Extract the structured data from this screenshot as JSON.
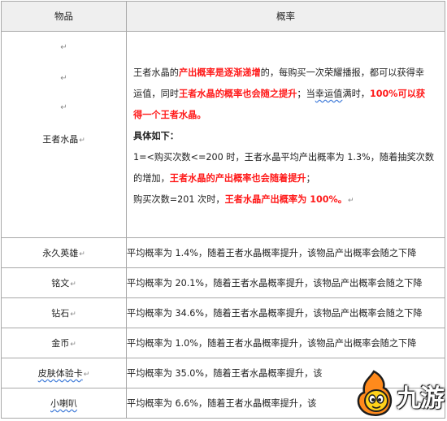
{
  "header": {
    "col1": "物品",
    "col2": "概率"
  },
  "para_mark": "↵",
  "crystal": {
    "name": "王者水晶",
    "line1_a": "王者水晶的",
    "line1_b": "产出概率是逐渐递增",
    "line1_c": "的，每购买一次荣耀播报，都可以获得幸",
    "line2_a": "运值，同时",
    "line2_b": "王者水晶的概率也会随之提升",
    "line2_c": "；当",
    "line2_d": "幸运值",
    "line2_e": "满时，",
    "line2_f": "100%可以获",
    "line3": "得一个王者水晶。",
    "detail_title": "具体如下：",
    "rule1": "1=<购买次数<=200 时，王者水晶平均产出概率为 1.3%，随着抽奖次数",
    "rule2_a": "的增加，",
    "rule2_b": "王者水晶的产出概率也会随着提升",
    "rule2_c": "；",
    "rule3_a": "购买次数=201 次时，",
    "rule3_b": "王者水晶产出概率为 100%。"
  },
  "rows": [
    {
      "item": "永久英雄",
      "prob": "平均概率为 1.4%，随着王者水晶概率提升，该物品产出概率会随之下降"
    },
    {
      "item": "铭文",
      "prob": "平均概率为 20.1%，随着王者水晶概率提升，该物品产出概率会随之下降"
    },
    {
      "item": "钻石",
      "prob": "平均概率为 34.6%，随着王者水晶概率提升，该物品产出概率会随之下降"
    },
    {
      "item": "金币",
      "prob": "平均概率为 1.0%，随着王者水晶概率提升，该物品产出概率会随之下降"
    },
    {
      "item": "皮肤体验卡",
      "prob": "平均概率为 35.0%，随着王者水晶概率提升，该"
    },
    {
      "item": "小喇叭",
      "prob": "平均概率为 6.6%，随着王者水晶概率提升，该"
    }
  ],
  "watermark": {
    "text": "九游",
    "colors": {
      "flame": "#ff8a1c",
      "body": "#ffd21a",
      "outline": "#1d1d1d"
    }
  }
}
